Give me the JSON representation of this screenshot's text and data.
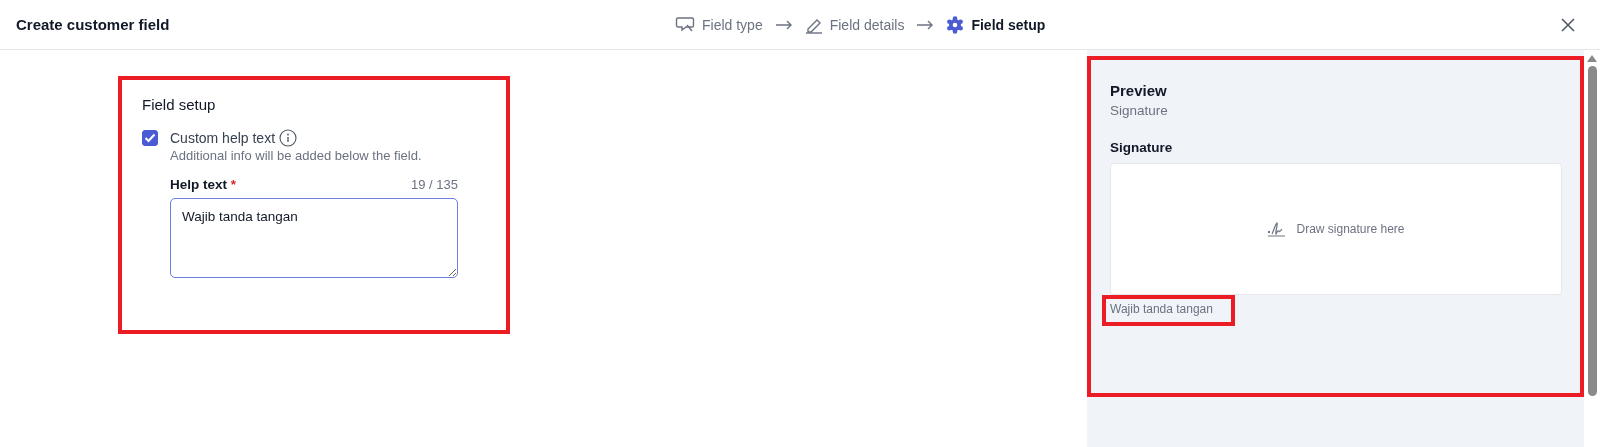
{
  "window": {
    "title": "Create customer field"
  },
  "steps": [
    {
      "label": "Field type",
      "kind": "type",
      "selected": false
    },
    {
      "label": "Field details",
      "kind": "details",
      "selected": false
    },
    {
      "label": "Field setup",
      "kind": "setup",
      "selected": true
    }
  ],
  "field_setup": {
    "title": "Field setup",
    "highlighted": true,
    "custom_help": {
      "label": "Custom help text",
      "checked": true,
      "description": "Additional info will be added below the field."
    },
    "help_text": {
      "label": "Help text",
      "required_mark": "*",
      "counter": "19 / 135",
      "value": "Wajib tanda tangan"
    }
  },
  "preview": {
    "highlighted": true,
    "title": "Preview",
    "subtitle": "Signature",
    "field_label": "Signature",
    "pad_placeholder": "Draw signature here",
    "help_text": "Wajib tanda tangan",
    "help_text_highlighted": true
  }
}
